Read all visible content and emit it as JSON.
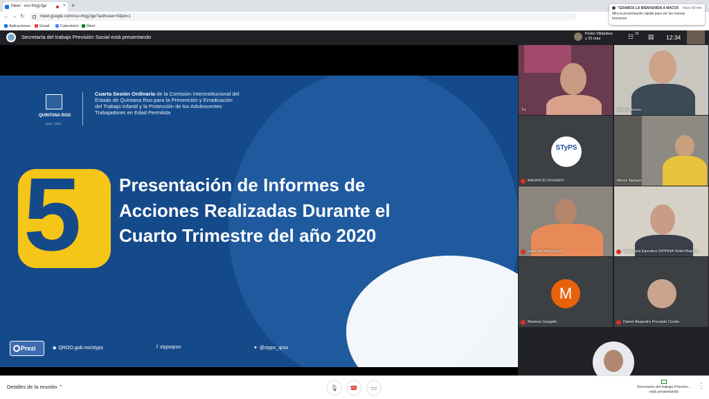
{
  "browser": {
    "tab_title": "Meet - xsv-fmgj-fge",
    "new_tab": "+",
    "url": "meet.google.com/xsv-fmgj-fge?authuser=0&pli=1",
    "bookmarks": [
      {
        "label": "Aplicaciones",
        "icon": "apps-icon",
        "color": "#1a73e8"
      },
      {
        "label": "Gmail",
        "icon": "gmail-icon",
        "color": "#ea4335"
      },
      {
        "label": "Calendario",
        "icon": "calendar-icon",
        "color": "#4285f4"
      },
      {
        "label": "Meet",
        "icon": "meet-icon",
        "color": "#00832d"
      }
    ]
  },
  "notification": {
    "title": "\"EDAMOS LA BIENVENIDA A MACOS...",
    "close": "Hace 40 min",
    "body": "Mira la presentación rápida para ver las nuevas funciones"
  },
  "meet": {
    "presenting_label": "Secretaría del trabajo Previsión Social está presentando",
    "participants_summary_1": "Pedro Villalobos",
    "participants_summary_2": "y 25 más",
    "participants_count": "26",
    "time": "12:34"
  },
  "slide": {
    "header_bold": "Cuarta Sesión Ordinaria",
    "header_rest": " de la Comisión Interinstitucional del Estado de Quintana Roo para la Prevención y Erradicación del Trabajo Infantil y la Protección de los Adolescentes Trabajadores en Edad Permitida",
    "crest_name": "QUINTANA ROO",
    "crest_years": "2016 – 2022",
    "number": "5",
    "title": "Presentación de Informes de Acciones Realizadas Durante el Cuarto Trimestre del año 2020",
    "prezi": "Prezi",
    "web": "QROO.gob.mx/styps",
    "facebook": "stypsqroo",
    "twitter": "@styps_qroo"
  },
  "tiles": [
    {
      "name": "Tú",
      "muted": false
    },
    {
      "name": "Marcos Torres",
      "muted": false
    },
    {
      "name": "MAURICIO ROSADO",
      "muted": true,
      "logo": "STyPS"
    },
    {
      "name": "Merce Tamayo",
      "muted": false
    },
    {
      "name": "Isaac Montiel Reyes",
      "muted": true
    },
    {
      "name": "Secretaría Ejecutiva SIPINNA Violet Mujeres",
      "muted": true
    },
    {
      "name": "Marlene Gargallo",
      "muted": true,
      "initial": "M"
    },
    {
      "name": "Daniel Alejandro Preciado Conde",
      "muted": true
    }
  ],
  "controls": {
    "meeting_details": "Detalles de la reunión",
    "presenting": "Secretaría del trabajo Previsio... está presentando"
  },
  "colors": {
    "slide_bg": "#154a8a",
    "accent_yellow": "#f5c518",
    "avatar_orange": "#e8620c",
    "end_call": "#d93025"
  }
}
